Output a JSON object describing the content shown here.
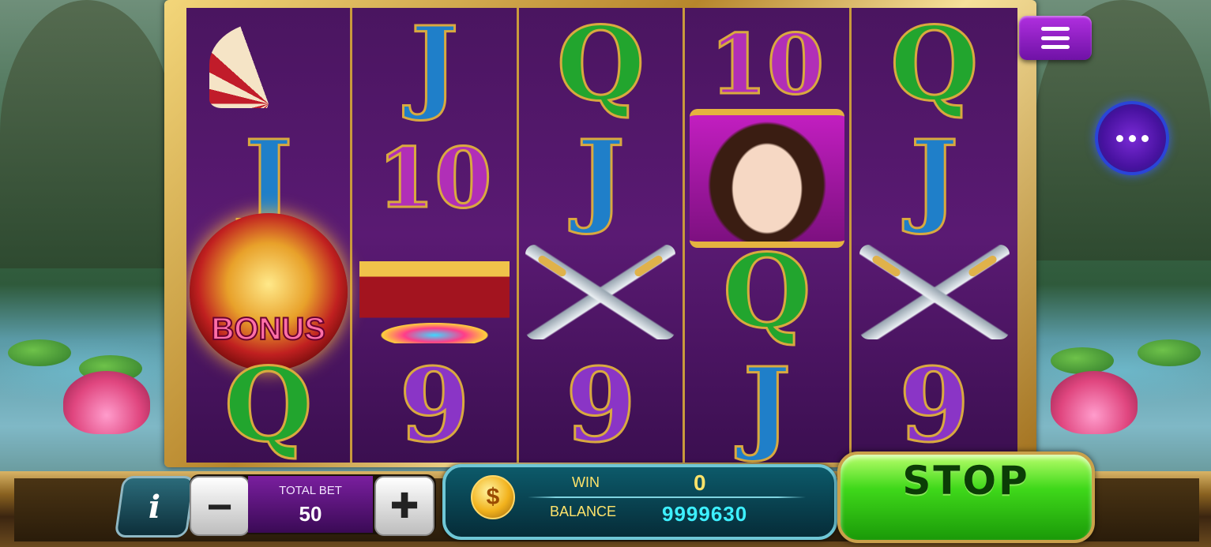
{
  "menu": {
    "icon": "hamburger-menu-icon"
  },
  "more": {
    "icon": "more-dots-icon"
  },
  "reels": [
    {
      "symbols": [
        "fan",
        "J",
        "bonus",
        "Q"
      ]
    },
    {
      "symbols": [
        "J",
        "10",
        "treasure-chest",
        "9"
      ]
    },
    {
      "symbols": [
        "Q",
        "J",
        "crossed-swords",
        "9"
      ]
    },
    {
      "symbols": [
        "10",
        "princess",
        "Q",
        "J"
      ]
    },
    {
      "symbols": [
        "Q",
        "J",
        "crossed-swords",
        "9"
      ]
    }
  ],
  "reel_text": {
    "r0": {
      "c1": "J",
      "c3": "Q",
      "bonus": "BONUS"
    },
    "r1": {
      "c0": "J",
      "c1": "10",
      "c3": "9"
    },
    "r2": {
      "c0": "Q",
      "c1": "J",
      "c3": "9"
    },
    "r3": {
      "c0": "10",
      "c2": "Q",
      "c3": "J"
    },
    "r4": {
      "c0": "Q",
      "c1": "J",
      "c3": "9"
    }
  },
  "controls": {
    "info_label": "i",
    "minus_label": "−",
    "plus_label": "✚",
    "total_bet_label": "TOTAL BET",
    "total_bet_value": "50",
    "coin_symbol": "$",
    "win_label": "WIN",
    "win_value": "0",
    "balance_label": "BALANCE",
    "balance_value": "9999630",
    "stop_label": "STOP"
  },
  "colors": {
    "reel_background": "#4a1560",
    "frame_gold": "#d9a93f",
    "stop_green": "#3fd81a",
    "menu_purple": "#8f1fd0",
    "balance_cyan": "#3ef0ff",
    "win_yellow": "#ffe36a"
  }
}
